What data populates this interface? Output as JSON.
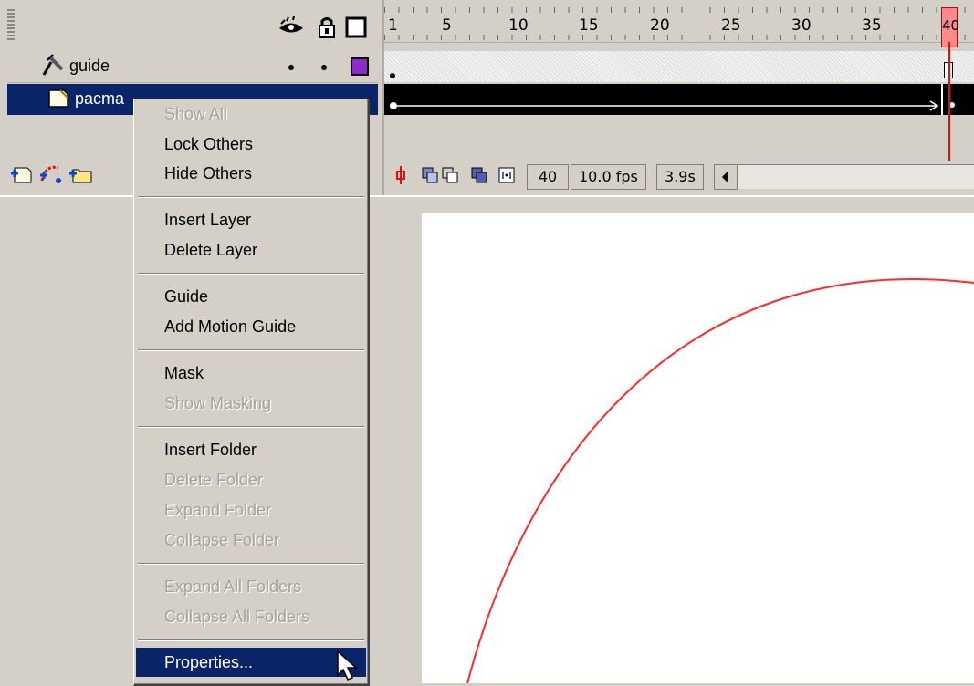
{
  "layers": [
    {
      "name": "guide",
      "icon": "motion-guide-icon",
      "outline_color": "#8e2bc8"
    },
    {
      "name": "pacma",
      "icon": "layer-icon",
      "selected": true
    }
  ],
  "ruler": {
    "labels": [
      "1",
      "5",
      "10",
      "15",
      "20",
      "25",
      "30",
      "35",
      "40"
    ]
  },
  "timeline_toolbar": {
    "current_frame": "40",
    "frame_rate": "10.0 fps",
    "elapsed_time": "3.9s"
  },
  "context_menu": {
    "items": [
      {
        "label": "Show All",
        "enabled": false
      },
      {
        "label": "Lock Others",
        "enabled": true
      },
      {
        "label": "Hide Others",
        "enabled": true
      },
      {
        "label": "Insert Layer",
        "enabled": true
      },
      {
        "label": "Delete Layer",
        "enabled": true
      },
      {
        "label": "Guide",
        "enabled": true
      },
      {
        "label": "Add Motion Guide",
        "enabled": true
      },
      {
        "label": "Mask",
        "enabled": true
      },
      {
        "label": "Show Masking",
        "enabled": false
      },
      {
        "label": "Insert Folder",
        "enabled": true
      },
      {
        "label": "Delete Folder",
        "enabled": false
      },
      {
        "label": "Expand Folder",
        "enabled": false
      },
      {
        "label": "Collapse Folder",
        "enabled": false
      },
      {
        "label": "Expand All Folders",
        "enabled": false
      },
      {
        "label": "Collapse All Folders",
        "enabled": false
      },
      {
        "label": "Properties...",
        "enabled": true,
        "highlighted": true
      }
    ]
  },
  "colors": {
    "selection": "#0a246a",
    "playhead": "#e01010",
    "guide_path": "#ff2a2a",
    "guide_outline": "#8e2bc8"
  }
}
